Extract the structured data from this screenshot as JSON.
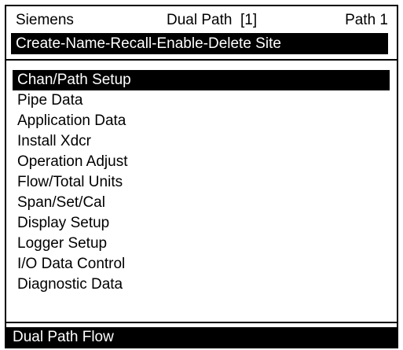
{
  "header": {
    "vendor": "Siemens",
    "mode": "Dual Path  [1]",
    "path": "Path 1"
  },
  "site_bar": {
    "label": "Create-Name-Recall-Enable-Delete Site"
  },
  "menu": {
    "selected_index": 0,
    "items": [
      {
        "label": "Chan/Path Setup"
      },
      {
        "label": "Pipe Data"
      },
      {
        "label": "Application Data"
      },
      {
        "label": "Install Xdcr"
      },
      {
        "label": "Operation Adjust"
      },
      {
        "label": "Flow/Total Units"
      },
      {
        "label": "Span/Set/Cal"
      },
      {
        "label": "Display Setup"
      },
      {
        "label": "Logger Setup"
      },
      {
        "label": "I/O Data Control"
      },
      {
        "label": "Diagnostic Data"
      }
    ]
  },
  "status_bar": {
    "label": "Dual Path Flow"
  },
  "colors": {
    "background": "#ffffff",
    "foreground": "#000000",
    "highlight": "#000000",
    "highlight_text": "#ffffff"
  }
}
